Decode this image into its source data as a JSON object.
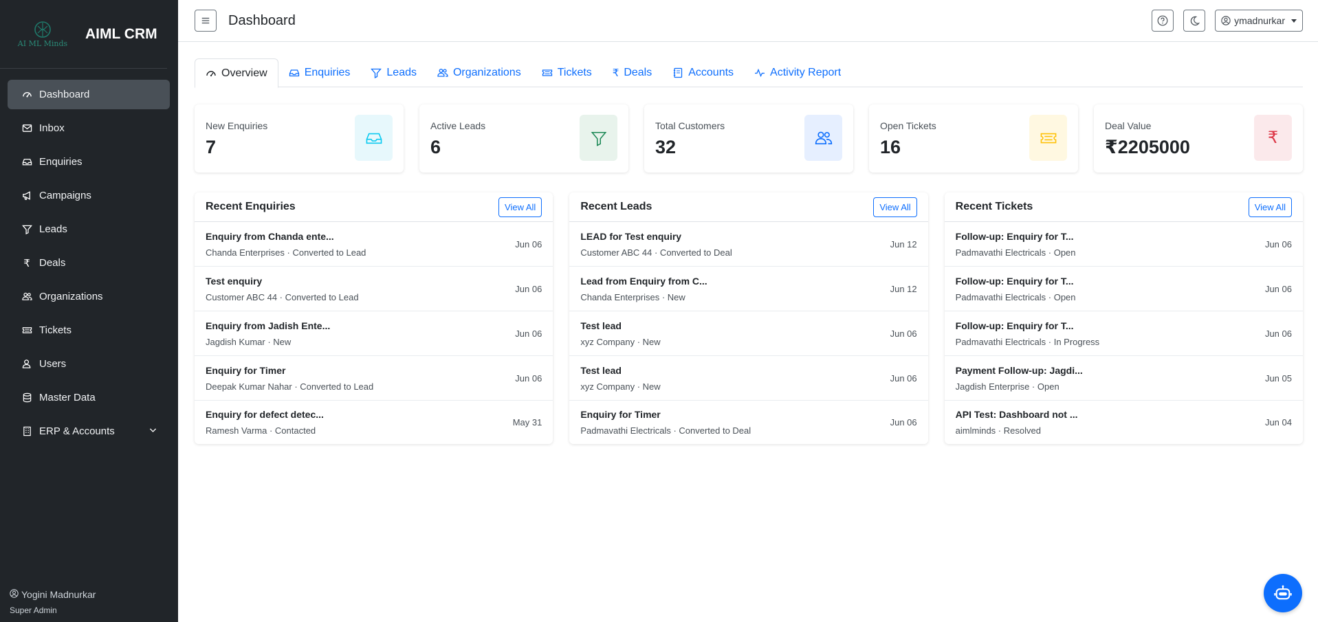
{
  "app": {
    "name": "AIML CRM",
    "logo_text": "AI ML Minds"
  },
  "sidebar": {
    "items": [
      {
        "label": "Dashboard",
        "icon": "gauge-icon",
        "active": true
      },
      {
        "label": "Inbox",
        "icon": "inbox-icon"
      },
      {
        "label": "Enquiries",
        "icon": "tray-icon"
      },
      {
        "label": "Campaigns",
        "icon": "megaphone-icon"
      },
      {
        "label": "Leads",
        "icon": "funnel-icon"
      },
      {
        "label": "Deals",
        "icon": "rupee-icon"
      },
      {
        "label": "Organizations",
        "icon": "people-icon"
      },
      {
        "label": "Tickets",
        "icon": "ticket-icon"
      },
      {
        "label": "Users",
        "icon": "person-icon"
      },
      {
        "label": "Master Data",
        "icon": "database-icon"
      },
      {
        "label": "ERP & Accounts",
        "icon": "building-icon"
      }
    ],
    "user_name": "Yogini Madnurkar",
    "user_role": "Super Admin"
  },
  "header": {
    "title": "Dashboard",
    "username": "ymadnurkar"
  },
  "tabs": [
    {
      "label": "Overview"
    },
    {
      "label": "Enquiries"
    },
    {
      "label": "Leads"
    },
    {
      "label": "Organizations"
    },
    {
      "label": "Tickets"
    },
    {
      "label": "Deals"
    },
    {
      "label": "Accounts"
    },
    {
      "label": "Activity Report"
    }
  ],
  "stats": [
    {
      "label": "New Enquiries",
      "value": "7",
      "icon": "tray-icon",
      "color": "#0dcaf0",
      "bg": "#e7f8fc"
    },
    {
      "label": "Active Leads",
      "value": "6",
      "icon": "funnel-icon",
      "color": "#198754",
      "bg": "#e8f3ec"
    },
    {
      "label": "Total Customers",
      "value": "32",
      "icon": "people-icon",
      "color": "#0d6efd",
      "bg": "#e6efff"
    },
    {
      "label": "Open Tickets",
      "value": "16",
      "icon": "ticket-icon",
      "color": "#ffc107",
      "bg": "#fff8e1"
    },
    {
      "label": "Deal Value",
      "value": "₹2205000",
      "icon": "rupee-icon",
      "color": "#dc3545",
      "bg": "#fbe9eb"
    }
  ],
  "panels": [
    {
      "title": "Recent Enquiries",
      "view_all": "View All",
      "rows": [
        {
          "title": "Enquiry from Chanda ente...",
          "sub": "Chanda Enterprises · Converted to Lead",
          "date": "Jun 06"
        },
        {
          "title": "Test enquiry",
          "sub": "Customer ABC 44 · Converted to Lead",
          "date": "Jun 06"
        },
        {
          "title": "Enquiry from Jadish Ente...",
          "sub": "Jagdish Kumar · New",
          "date": "Jun 06"
        },
        {
          "title": "Enquiry for Timer",
          "sub": "Deepak Kumar Nahar · Converted to Lead",
          "date": "Jun 06"
        },
        {
          "title": "Enquiry for defect detec...",
          "sub": "Ramesh Varma · Contacted",
          "date": "May 31"
        }
      ]
    },
    {
      "title": "Recent Leads",
      "view_all": "View All",
      "rows": [
        {
          "title": "LEAD for Test enquiry",
          "sub": "Customer ABC 44 · Converted to Deal",
          "date": "Jun 12"
        },
        {
          "title": "Lead from Enquiry from C...",
          "sub": "Chanda Enterprises · New",
          "date": "Jun 12"
        },
        {
          "title": "Test lead",
          "sub": "xyz Company · New",
          "date": "Jun 06"
        },
        {
          "title": "Test lead",
          "sub": "xyz Company · New",
          "date": "Jun 06"
        },
        {
          "title": "Enquiry for Timer",
          "sub": "Padmavathi Electricals · Converted to Deal",
          "date": "Jun 06"
        }
      ]
    },
    {
      "title": "Recent Tickets",
      "view_all": "View All",
      "rows": [
        {
          "title": "Follow-up: Enquiry for T...",
          "sub": "Padmavathi Electricals · Open",
          "date": "Jun 06"
        },
        {
          "title": "Follow-up: Enquiry for T...",
          "sub": "Padmavathi Electricals · Open",
          "date": "Jun 06"
        },
        {
          "title": "Follow-up: Enquiry for T...",
          "sub": "Padmavathi Electricals · In Progress",
          "date": "Jun 06"
        },
        {
          "title": "Payment Follow-up: Jagdi...",
          "sub": "Jagdish Enterprise · Open",
          "date": "Jun 05"
        },
        {
          "title": "API Test: Dashboard not ...",
          "sub": "aimlminds · Resolved",
          "date": "Jun 04"
        }
      ]
    }
  ],
  "colors": {
    "primary": "#0d6efd",
    "sidebar": "#212529",
    "active_item": "#495057"
  }
}
